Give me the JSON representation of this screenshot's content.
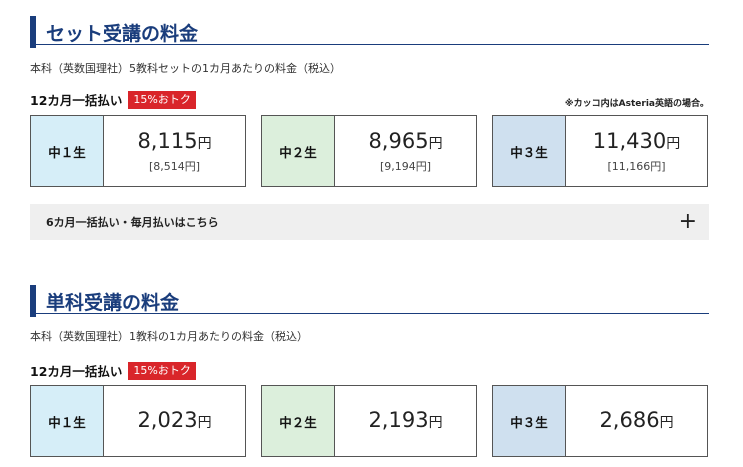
{
  "colors": {
    "accent": "#1a3d7c",
    "badge": "#d9252a",
    "grade1": "#d6eef8",
    "grade2": "#dcefdc",
    "grade3": "#cfe0ef"
  },
  "set": {
    "title": "セット受講の料金",
    "note": "本科（英数国理社）5教科セットの1カ月あたりの料金（税込）",
    "plan_label": "12カ月一括払い",
    "badge": "15%おトク",
    "footnote": "※カッコ内はAsteria英語の場合。",
    "currency": "円",
    "cards": [
      {
        "grade": "中１生",
        "price": "8,115",
        "sub": "[8,514円]"
      },
      {
        "grade": "中２生",
        "price": "8,965",
        "sub": "[9,194円]"
      },
      {
        "grade": "中３生",
        "price": "11,430",
        "sub": "[11,166円]"
      }
    ],
    "accordion_label": "6カ月一括払い・毎月払いはこちら",
    "accordion_icon": "plus-icon"
  },
  "single": {
    "title": "単科受講の料金",
    "note": "本科（英数国理社）1教科の1カ月あたりの料金（税込）",
    "plan_label": "12カ月一括払い",
    "badge": "15%おトク",
    "currency": "円",
    "cards": [
      {
        "grade": "中１生",
        "price": "2,023"
      },
      {
        "grade": "中２生",
        "price": "2,193"
      },
      {
        "grade": "中３生",
        "price": "2,686"
      }
    ]
  }
}
